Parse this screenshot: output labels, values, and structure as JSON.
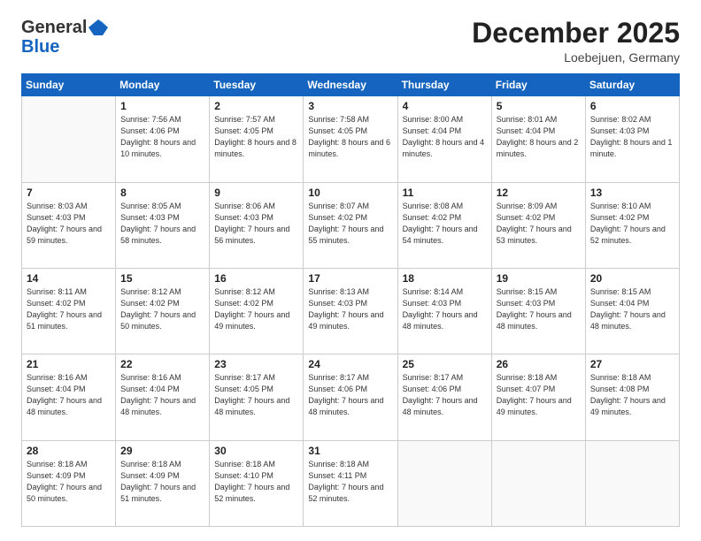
{
  "logo": {
    "general": "General",
    "blue": "Blue"
  },
  "header": {
    "month": "December 2025",
    "location": "Loebejuen, Germany"
  },
  "days_of_week": [
    "Sunday",
    "Monday",
    "Tuesday",
    "Wednesday",
    "Thursday",
    "Friday",
    "Saturday"
  ],
  "weeks": [
    [
      {
        "num": "",
        "sunrise": "",
        "sunset": "",
        "daylight": ""
      },
      {
        "num": "1",
        "sunrise": "Sunrise: 7:56 AM",
        "sunset": "Sunset: 4:06 PM",
        "daylight": "Daylight: 8 hours and 10 minutes."
      },
      {
        "num": "2",
        "sunrise": "Sunrise: 7:57 AM",
        "sunset": "Sunset: 4:05 PM",
        "daylight": "Daylight: 8 hours and 8 minutes."
      },
      {
        "num": "3",
        "sunrise": "Sunrise: 7:58 AM",
        "sunset": "Sunset: 4:05 PM",
        "daylight": "Daylight: 8 hours and 6 minutes."
      },
      {
        "num": "4",
        "sunrise": "Sunrise: 8:00 AM",
        "sunset": "Sunset: 4:04 PM",
        "daylight": "Daylight: 8 hours and 4 minutes."
      },
      {
        "num": "5",
        "sunrise": "Sunrise: 8:01 AM",
        "sunset": "Sunset: 4:04 PM",
        "daylight": "Daylight: 8 hours and 2 minutes."
      },
      {
        "num": "6",
        "sunrise": "Sunrise: 8:02 AM",
        "sunset": "Sunset: 4:03 PM",
        "daylight": "Daylight: 8 hours and 1 minute."
      }
    ],
    [
      {
        "num": "7",
        "sunrise": "Sunrise: 8:03 AM",
        "sunset": "Sunset: 4:03 PM",
        "daylight": "Daylight: 7 hours and 59 minutes."
      },
      {
        "num": "8",
        "sunrise": "Sunrise: 8:05 AM",
        "sunset": "Sunset: 4:03 PM",
        "daylight": "Daylight: 7 hours and 58 minutes."
      },
      {
        "num": "9",
        "sunrise": "Sunrise: 8:06 AM",
        "sunset": "Sunset: 4:03 PM",
        "daylight": "Daylight: 7 hours and 56 minutes."
      },
      {
        "num": "10",
        "sunrise": "Sunrise: 8:07 AM",
        "sunset": "Sunset: 4:02 PM",
        "daylight": "Daylight: 7 hours and 55 minutes."
      },
      {
        "num": "11",
        "sunrise": "Sunrise: 8:08 AM",
        "sunset": "Sunset: 4:02 PM",
        "daylight": "Daylight: 7 hours and 54 minutes."
      },
      {
        "num": "12",
        "sunrise": "Sunrise: 8:09 AM",
        "sunset": "Sunset: 4:02 PM",
        "daylight": "Daylight: 7 hours and 53 minutes."
      },
      {
        "num": "13",
        "sunrise": "Sunrise: 8:10 AM",
        "sunset": "Sunset: 4:02 PM",
        "daylight": "Daylight: 7 hours and 52 minutes."
      }
    ],
    [
      {
        "num": "14",
        "sunrise": "Sunrise: 8:11 AM",
        "sunset": "Sunset: 4:02 PM",
        "daylight": "Daylight: 7 hours and 51 minutes."
      },
      {
        "num": "15",
        "sunrise": "Sunrise: 8:12 AM",
        "sunset": "Sunset: 4:02 PM",
        "daylight": "Daylight: 7 hours and 50 minutes."
      },
      {
        "num": "16",
        "sunrise": "Sunrise: 8:12 AM",
        "sunset": "Sunset: 4:02 PM",
        "daylight": "Daylight: 7 hours and 49 minutes."
      },
      {
        "num": "17",
        "sunrise": "Sunrise: 8:13 AM",
        "sunset": "Sunset: 4:03 PM",
        "daylight": "Daylight: 7 hours and 49 minutes."
      },
      {
        "num": "18",
        "sunrise": "Sunrise: 8:14 AM",
        "sunset": "Sunset: 4:03 PM",
        "daylight": "Daylight: 7 hours and 48 minutes."
      },
      {
        "num": "19",
        "sunrise": "Sunrise: 8:15 AM",
        "sunset": "Sunset: 4:03 PM",
        "daylight": "Daylight: 7 hours and 48 minutes."
      },
      {
        "num": "20",
        "sunrise": "Sunrise: 8:15 AM",
        "sunset": "Sunset: 4:04 PM",
        "daylight": "Daylight: 7 hours and 48 minutes."
      }
    ],
    [
      {
        "num": "21",
        "sunrise": "Sunrise: 8:16 AM",
        "sunset": "Sunset: 4:04 PM",
        "daylight": "Daylight: 7 hours and 48 minutes."
      },
      {
        "num": "22",
        "sunrise": "Sunrise: 8:16 AM",
        "sunset": "Sunset: 4:04 PM",
        "daylight": "Daylight: 7 hours and 48 minutes."
      },
      {
        "num": "23",
        "sunrise": "Sunrise: 8:17 AM",
        "sunset": "Sunset: 4:05 PM",
        "daylight": "Daylight: 7 hours and 48 minutes."
      },
      {
        "num": "24",
        "sunrise": "Sunrise: 8:17 AM",
        "sunset": "Sunset: 4:06 PM",
        "daylight": "Daylight: 7 hours and 48 minutes."
      },
      {
        "num": "25",
        "sunrise": "Sunrise: 8:17 AM",
        "sunset": "Sunset: 4:06 PM",
        "daylight": "Daylight: 7 hours and 48 minutes."
      },
      {
        "num": "26",
        "sunrise": "Sunrise: 8:18 AM",
        "sunset": "Sunset: 4:07 PM",
        "daylight": "Daylight: 7 hours and 49 minutes."
      },
      {
        "num": "27",
        "sunrise": "Sunrise: 8:18 AM",
        "sunset": "Sunset: 4:08 PM",
        "daylight": "Daylight: 7 hours and 49 minutes."
      }
    ],
    [
      {
        "num": "28",
        "sunrise": "Sunrise: 8:18 AM",
        "sunset": "Sunset: 4:09 PM",
        "daylight": "Daylight: 7 hours and 50 minutes."
      },
      {
        "num": "29",
        "sunrise": "Sunrise: 8:18 AM",
        "sunset": "Sunset: 4:09 PM",
        "daylight": "Daylight: 7 hours and 51 minutes."
      },
      {
        "num": "30",
        "sunrise": "Sunrise: 8:18 AM",
        "sunset": "Sunset: 4:10 PM",
        "daylight": "Daylight: 7 hours and 52 minutes."
      },
      {
        "num": "31",
        "sunrise": "Sunrise: 8:18 AM",
        "sunset": "Sunset: 4:11 PM",
        "daylight": "Daylight: 7 hours and 52 minutes."
      },
      {
        "num": "",
        "sunrise": "",
        "sunset": "",
        "daylight": ""
      },
      {
        "num": "",
        "sunrise": "",
        "sunset": "",
        "daylight": ""
      },
      {
        "num": "",
        "sunrise": "",
        "sunset": "",
        "daylight": ""
      }
    ]
  ]
}
